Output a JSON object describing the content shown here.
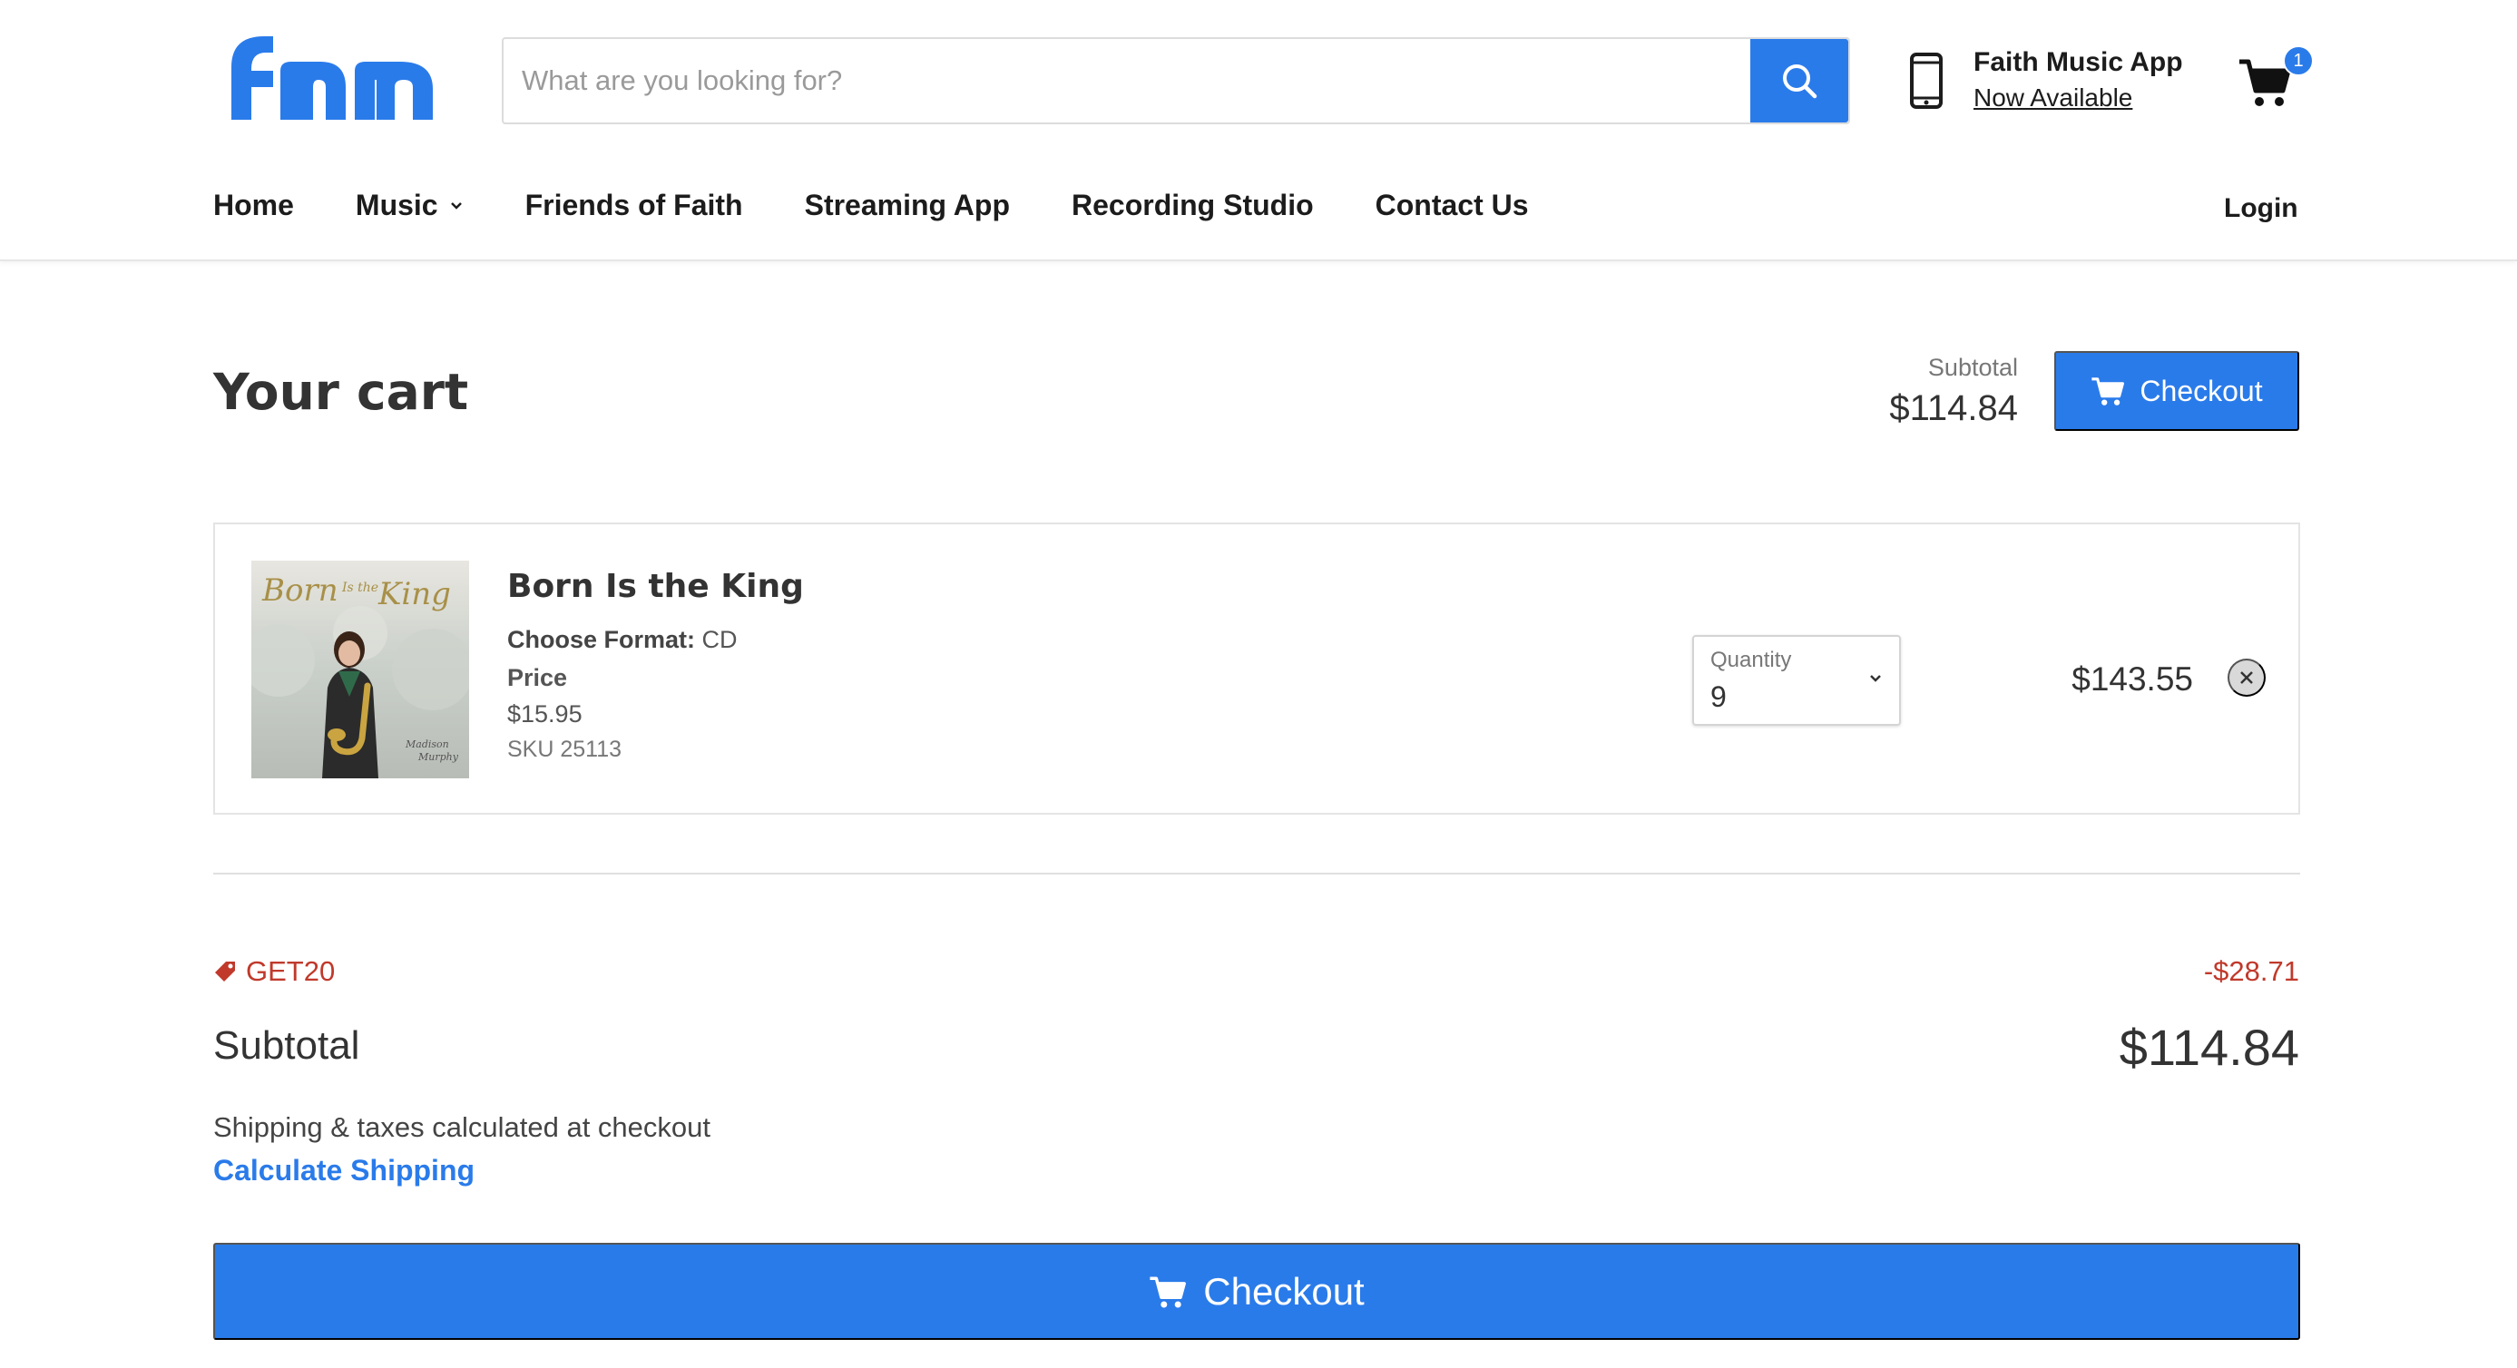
{
  "header": {
    "logo_text": "fmm",
    "search": {
      "placeholder": "What are you looking for?",
      "value": ""
    },
    "app_promo": {
      "title": "Faith Music App",
      "link": "Now Available"
    },
    "cart": {
      "count": "1"
    },
    "nav": {
      "items": [
        {
          "label": "Home"
        },
        {
          "label": "Music",
          "has_dropdown": true
        },
        {
          "label": "Friends of Faith"
        },
        {
          "label": "Streaming App"
        },
        {
          "label": "Recording Studio"
        },
        {
          "label": "Contact Us"
        }
      ],
      "login": "Login"
    }
  },
  "cart_page": {
    "title": "Your cart",
    "top_subtotal_label": "Subtotal",
    "top_subtotal_value": "$114.84",
    "checkout_label": "Checkout",
    "item": {
      "name": "Born Is the King",
      "format_label": "Choose Format:",
      "format_value": "CD",
      "price_label": "Price",
      "price": "$15.95",
      "sku": "SKU 25113",
      "quantity_label": "Quantity",
      "quantity": "9",
      "line_total": "$143.55",
      "thumb_title": "Born Is the King",
      "thumb_artist": "Madison Murphy"
    },
    "summary": {
      "discount_code": "GET20",
      "discount_amount": "-$28.71",
      "subtotal_label": "Subtotal",
      "subtotal_value": "$114.84",
      "shipping_note": "Shipping & taxes calculated at checkout",
      "calculate_shipping": "Calculate Shipping",
      "checkout_label": "Checkout"
    }
  },
  "colors": {
    "accent": "#2a7bea",
    "discount": "#c0392b",
    "logo": "#2a7bea"
  }
}
